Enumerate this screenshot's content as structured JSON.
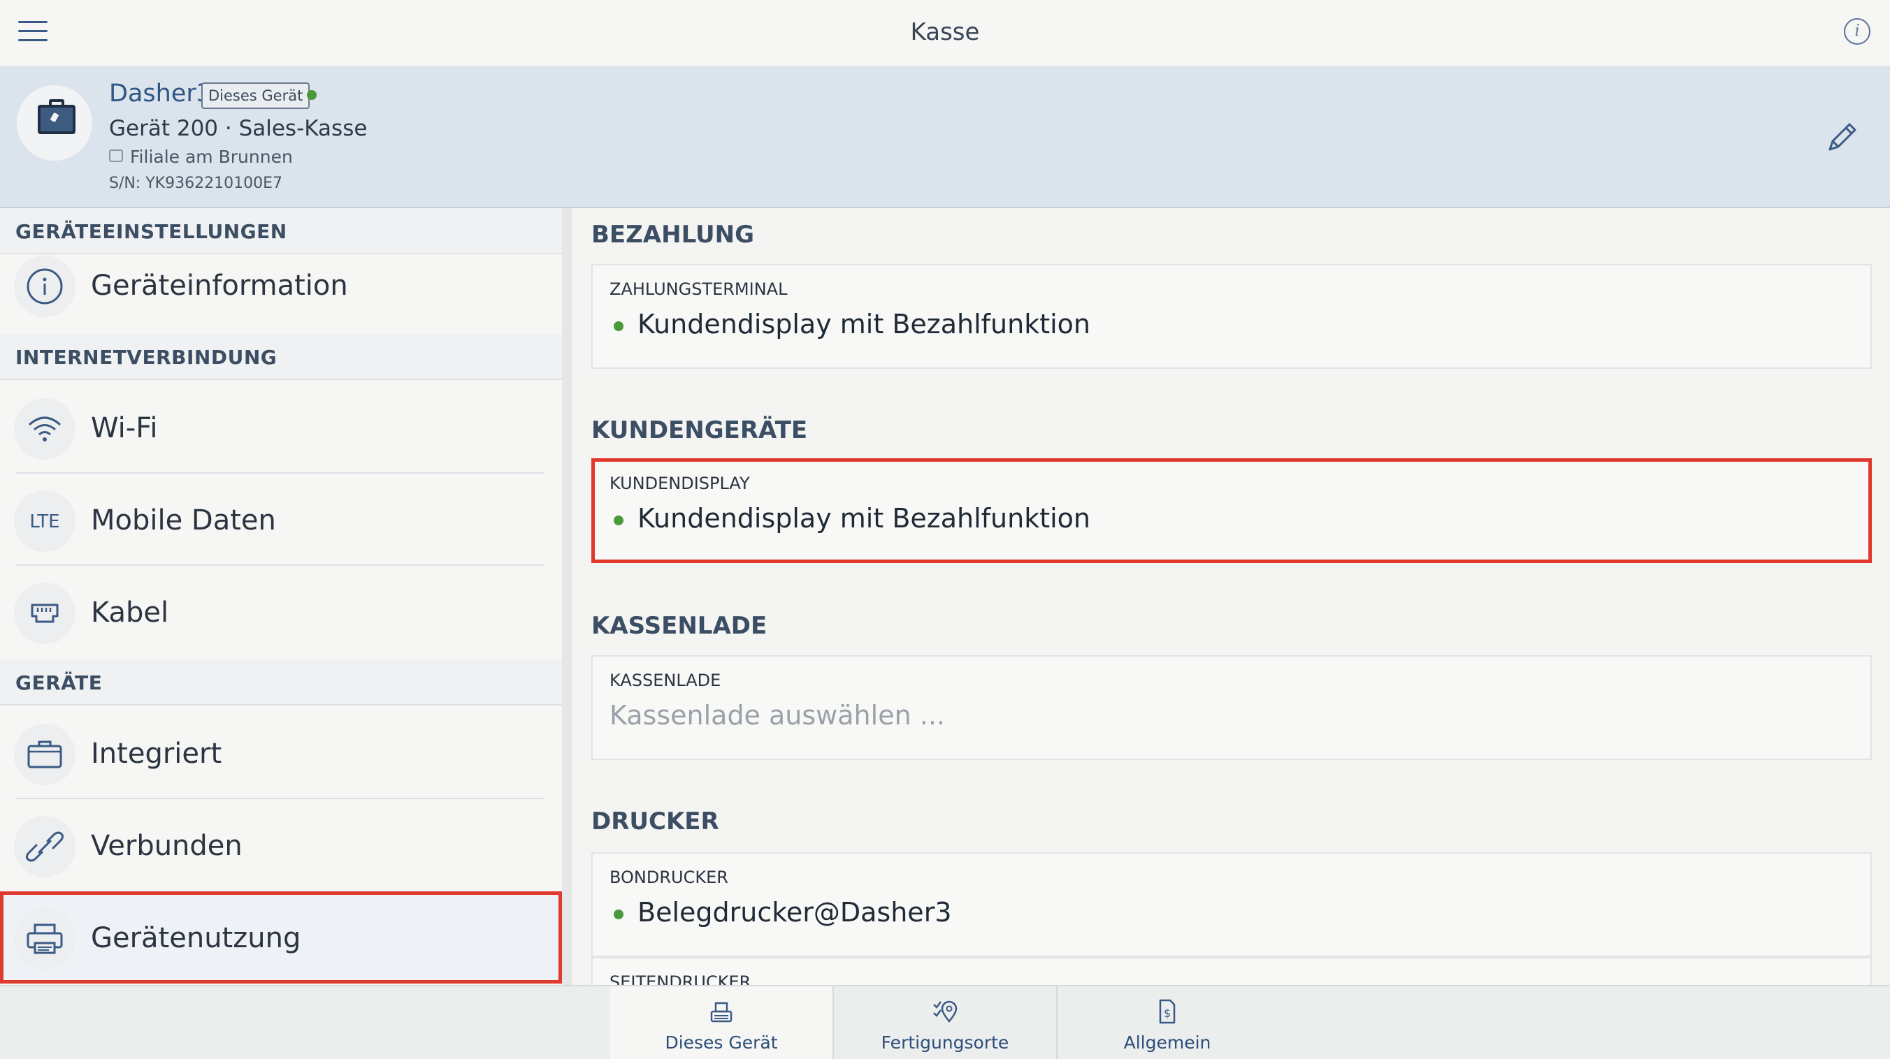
{
  "app": {
    "title": "Kasse"
  },
  "device": {
    "name": "Dasher3",
    "badge": "Dieses Gerät",
    "subtitle": "Gerät 200 · Sales-Kasse",
    "branch": "Filiale am Brunnen",
    "serial": "S/N: YK9362210100E7",
    "status_color": "#4a9a3c"
  },
  "sidebar": {
    "sections": [
      {
        "title": "GERÄTEEINSTELLUNGEN",
        "items": [
          {
            "label": "Geräteinformation",
            "icon": "info-icon"
          }
        ]
      },
      {
        "title": "INTERNETVERBINDUNG",
        "items": [
          {
            "label": "Wi-Fi",
            "icon": "wifi-icon"
          },
          {
            "label": "Mobile Daten",
            "icon": "lte-icon",
            "icon_text": "LTE"
          },
          {
            "label": "Kabel",
            "icon": "ethernet-icon"
          }
        ]
      },
      {
        "title": "GERÄTE",
        "items": [
          {
            "label": "Integriert",
            "icon": "briefcase-icon"
          },
          {
            "label": "Verbunden",
            "icon": "link-icon"
          },
          {
            "label": "Gerätenutzung",
            "icon": "printer-icon",
            "selected": true
          }
        ]
      }
    ]
  },
  "main": {
    "groups": [
      {
        "title": "BEZAHLUNG",
        "cards": [
          {
            "caption": "ZAHLUNGSTERMINAL",
            "value": "Kundendisplay mit Bezahlfunktion"
          }
        ]
      },
      {
        "title": "KUNDENGERÄTE",
        "cards": [
          {
            "caption": "KUNDENDISPLAY",
            "value": "Kundendisplay mit Bezahlfunktion"
          }
        ]
      },
      {
        "title": "KASSENLADE",
        "cards": [
          {
            "caption": "KASSENLADE",
            "placeholder": "Kassenlade auswählen ..."
          }
        ]
      },
      {
        "title": "DRUCKER",
        "cards": [
          {
            "caption": "BONDRUCKER",
            "value": "Belegdrucker@Dasher3"
          },
          {
            "caption": "SEITENDRUCKER"
          }
        ]
      }
    ]
  },
  "tabs": [
    {
      "label": "Dieses Gerät",
      "icon": "register-icon",
      "active": true
    },
    {
      "label": "Fertigungsorte",
      "icon": "location-check-icon"
    },
    {
      "label": "Allgemein",
      "icon": "document-dollar-icon"
    }
  ],
  "colors": {
    "accent": "#2d4e7a",
    "highlight": "#e03a2f",
    "status_ok": "#4a9a3c"
  }
}
